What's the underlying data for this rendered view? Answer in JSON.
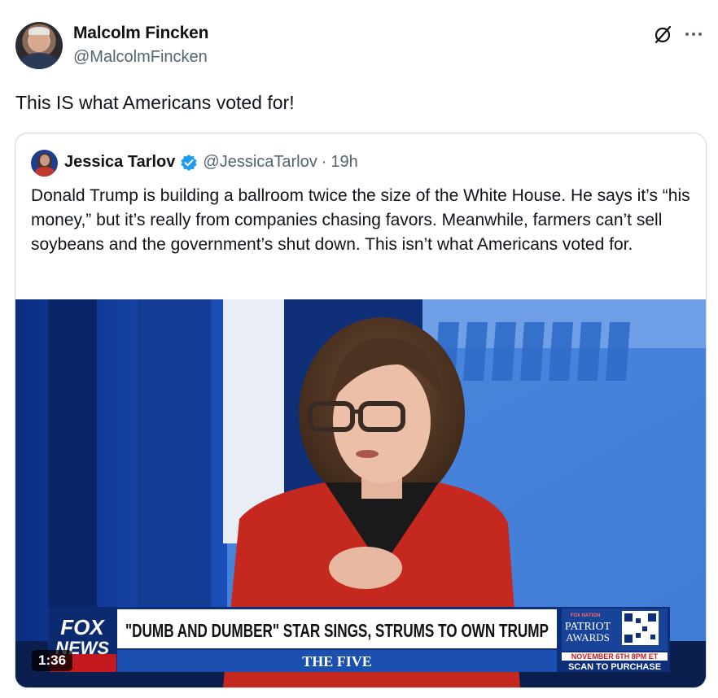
{
  "author": {
    "display_name": "Malcolm Fincken",
    "handle": "@MalcolmFincken"
  },
  "tweet": {
    "text": "This IS what Americans voted for!"
  },
  "quoted": {
    "display_name": "Jessica Tarlov",
    "handle": "@JessicaTarlov",
    "separator": "·",
    "time": "19h",
    "text": "Donald Trump is building a ballroom twice the size of the White House. He says it’s “his money,” but it’s really from companies chasing favors. Meanwhile, farmers can’t sell soybeans and the government’s shut down. This isn’t what Americans voted for.",
    "media": {
      "duration": "1:36",
      "chyron_headline": "\"DUMB AND DUMBER\" STAR SINGS, STRUMS TO OWN TRUMP",
      "show_name": "THE FIVE",
      "logo_top": "FOX",
      "logo_bottom": "NEWS",
      "promo_brand": "FOX NATION",
      "promo_title_1": "PATRIOT",
      "promo_title_2": "AWARDS",
      "promo_date": "NOVEMBER 6TH 8PM ET",
      "promo_cta": "SCAN TO PURCHASE"
    }
  },
  "icons": [
    "grok-icon",
    "more-icon",
    "verified-badge-icon"
  ],
  "colors": {
    "text": "#0f1419",
    "secondary": "#536471",
    "border": "#cfd9de",
    "verified": "#1d9bf0",
    "fox_red": "#c41a1f",
    "fox_blue": "#0d2f7a"
  }
}
